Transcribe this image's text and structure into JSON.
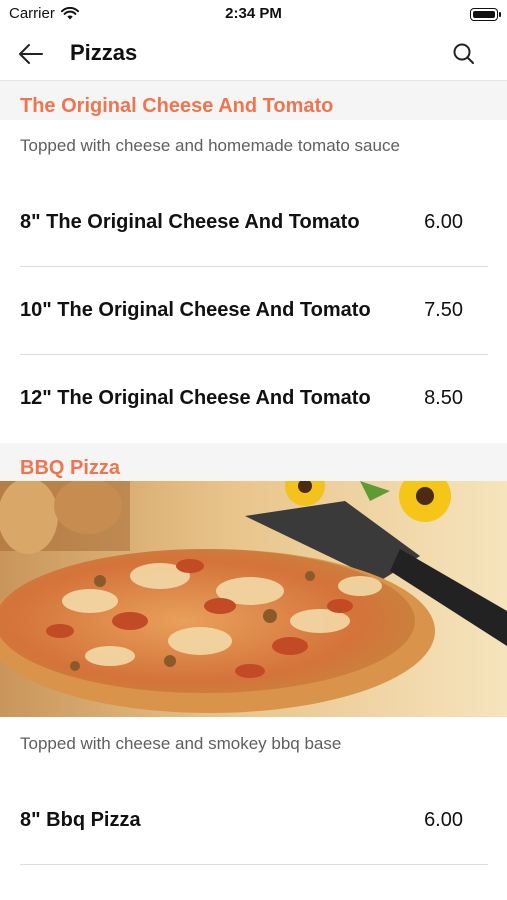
{
  "status": {
    "carrier": "Carrier",
    "time": "2:34 PM"
  },
  "nav": {
    "title": "Pizzas",
    "back_icon": "arrow-left-icon",
    "search_icon": "search-icon"
  },
  "sections": [
    {
      "title": "The Original Cheese And Tomato",
      "description": "Topped with cheese and homemade tomato sauce",
      "items": [
        {
          "name": "8\" The Original Cheese And Tomato",
          "price": "6.00"
        },
        {
          "name": "10\" The Original Cheese And Tomato",
          "price": "7.50"
        },
        {
          "name": "12\" The Original Cheese And Tomato",
          "price": "8.50"
        }
      ]
    },
    {
      "title": "BBQ Pizza",
      "image": "bbq-pizza-photo",
      "description": "Topped with cheese and smokey bbq base",
      "items": [
        {
          "name": "8\" Bbq Pizza",
          "price": "6.00"
        }
      ]
    }
  ],
  "colors": {
    "accent": "#f0754f",
    "section_bg": "#f5f5f5",
    "divider": "#dcdcdc",
    "description": "#5f5f5f"
  }
}
